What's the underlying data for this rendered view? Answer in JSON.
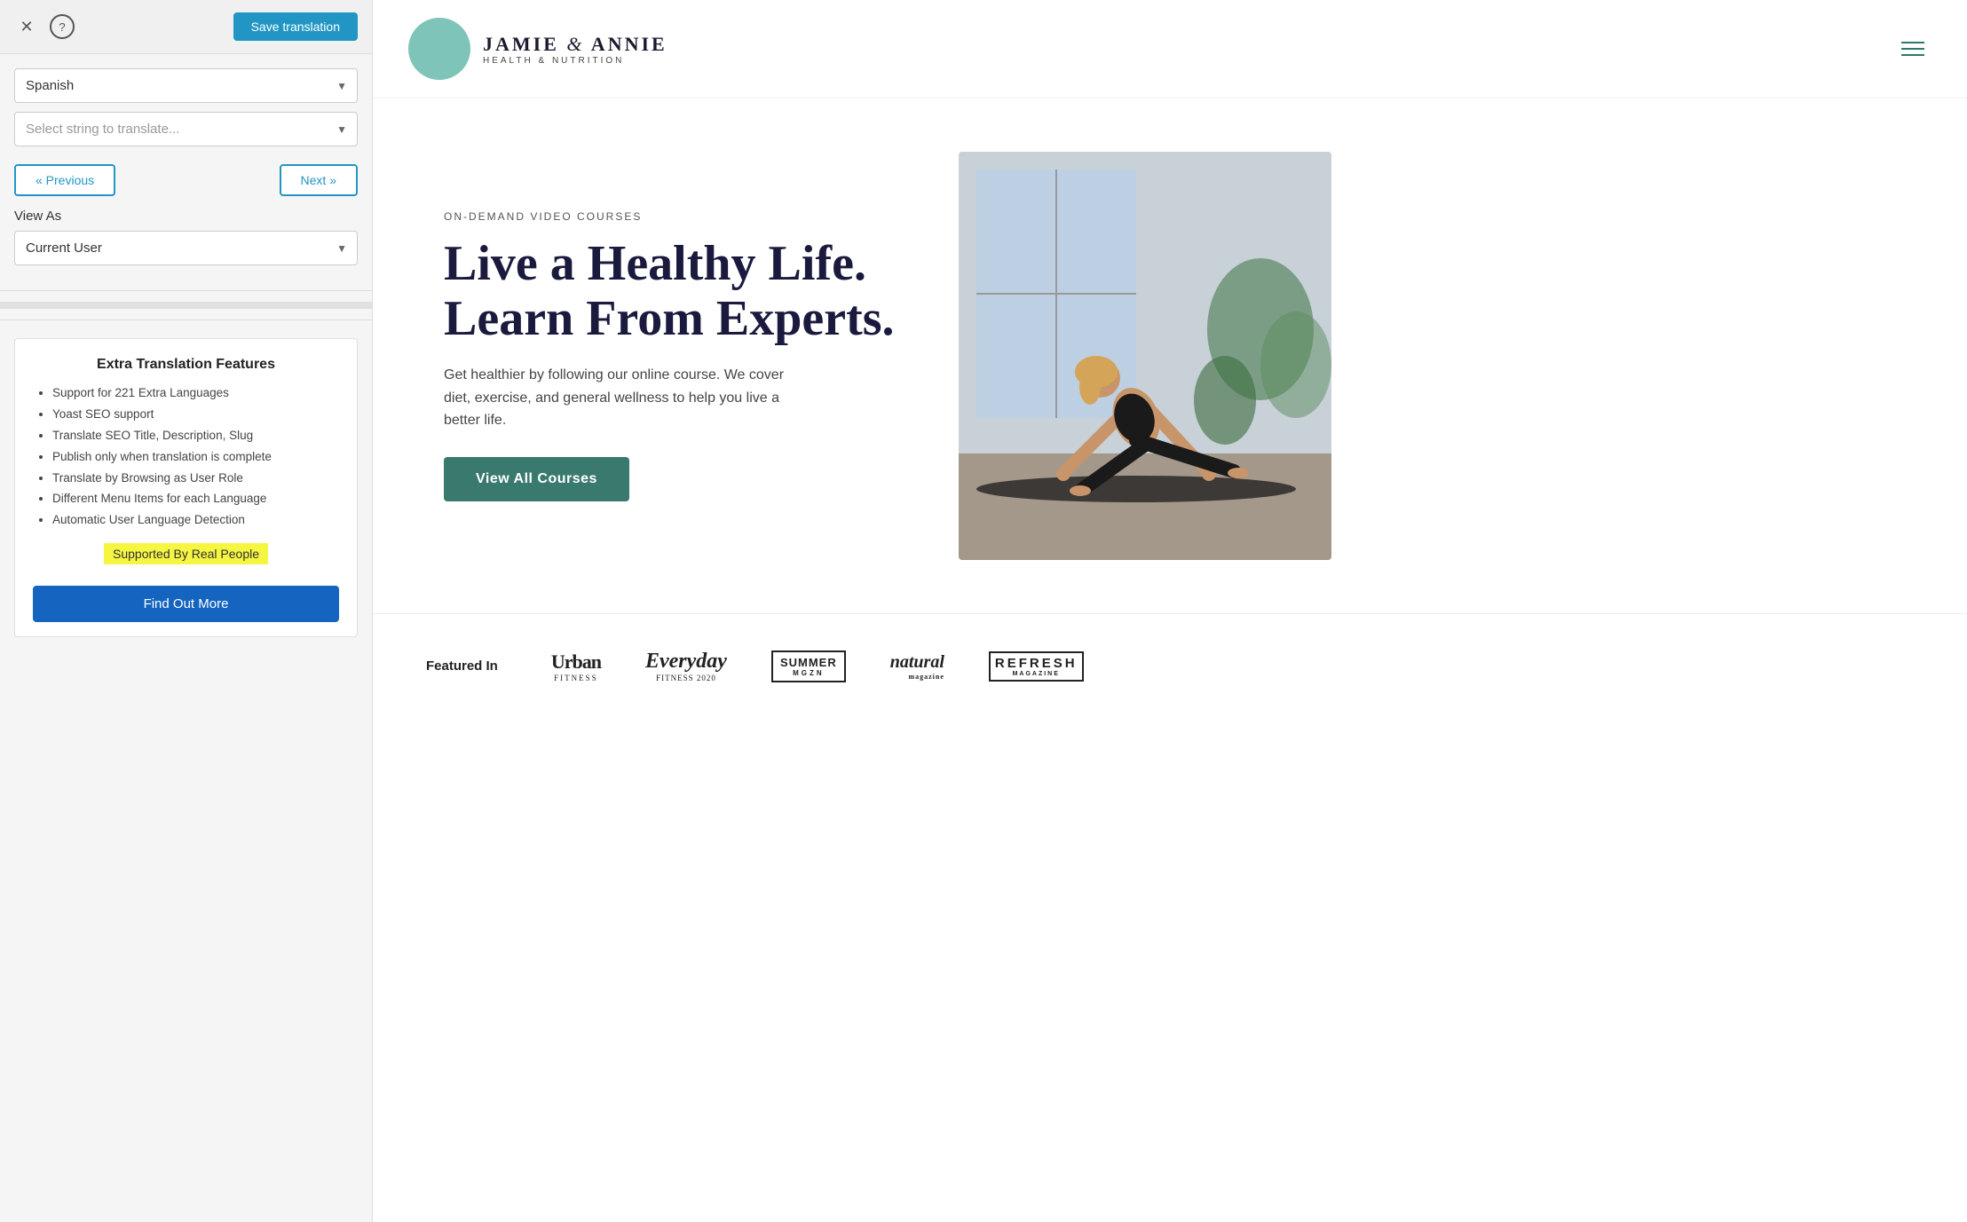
{
  "panel": {
    "close_label": "✕",
    "help_label": "?",
    "save_btn": "Save translation",
    "language_selected": "Spanish",
    "language_placeholder": "Spanish",
    "string_placeholder": "Select string to translate...",
    "prev_btn": "« Previous",
    "next_btn": "Next »",
    "view_as_label": "View As",
    "current_user_option": "Current User",
    "extra_features": {
      "title": "Extra Translation Features",
      "items": [
        "Support for 221 Extra Languages",
        "Yoast SEO support",
        "Translate SEO Title, Description, Slug",
        "Publish only when translation is complete",
        "Translate by Browsing as User Role",
        "Different Menu Items for each Language",
        "Automatic User Language Detection"
      ],
      "supported_label": "Supported By Real People",
      "find_out_more_btn": "Find Out More"
    }
  },
  "site": {
    "logo_main": "JAMIE",
    "logo_amp": "&",
    "logo_second": "ANNIE",
    "logo_sub": "HEALTH & NUTRITION",
    "nav_hamburger_label": "menu"
  },
  "hero": {
    "tag": "ON-DEMAND VIDEO COURSES",
    "title": "Live a Healthy Life. Learn From Experts.",
    "description": "Get healthier by following our online course. We cover diet, exercise, and general wellness to help you live a better life.",
    "cta_btn": "View All Courses"
  },
  "featured": {
    "label": "Featured In",
    "logos": [
      {
        "name": "Urban Fitness",
        "style": "urban",
        "main": "Urban",
        "sub": "FITNESS"
      },
      {
        "name": "Everyday Fitness 2020",
        "style": "everyday",
        "main": "Everyday",
        "sub": "FITNESS 2020"
      },
      {
        "name": "Summer Magazine",
        "style": "summer",
        "main": "SUMMER",
        "sub": "MGZN"
      },
      {
        "name": "Natural Magazine",
        "style": "natural",
        "main": "natural",
        "sub": "magazine"
      },
      {
        "name": "Refresh Magazine",
        "style": "refresh",
        "main": "REFRESH",
        "sub": "MAGAZINE"
      }
    ]
  },
  "colors": {
    "primary_btn": "#2196c4",
    "nav_accent": "#2a7a6b",
    "hero_btn": "#3a7a6e",
    "hero_title": "#1a1a3e",
    "highlighted": "#f5f542"
  }
}
